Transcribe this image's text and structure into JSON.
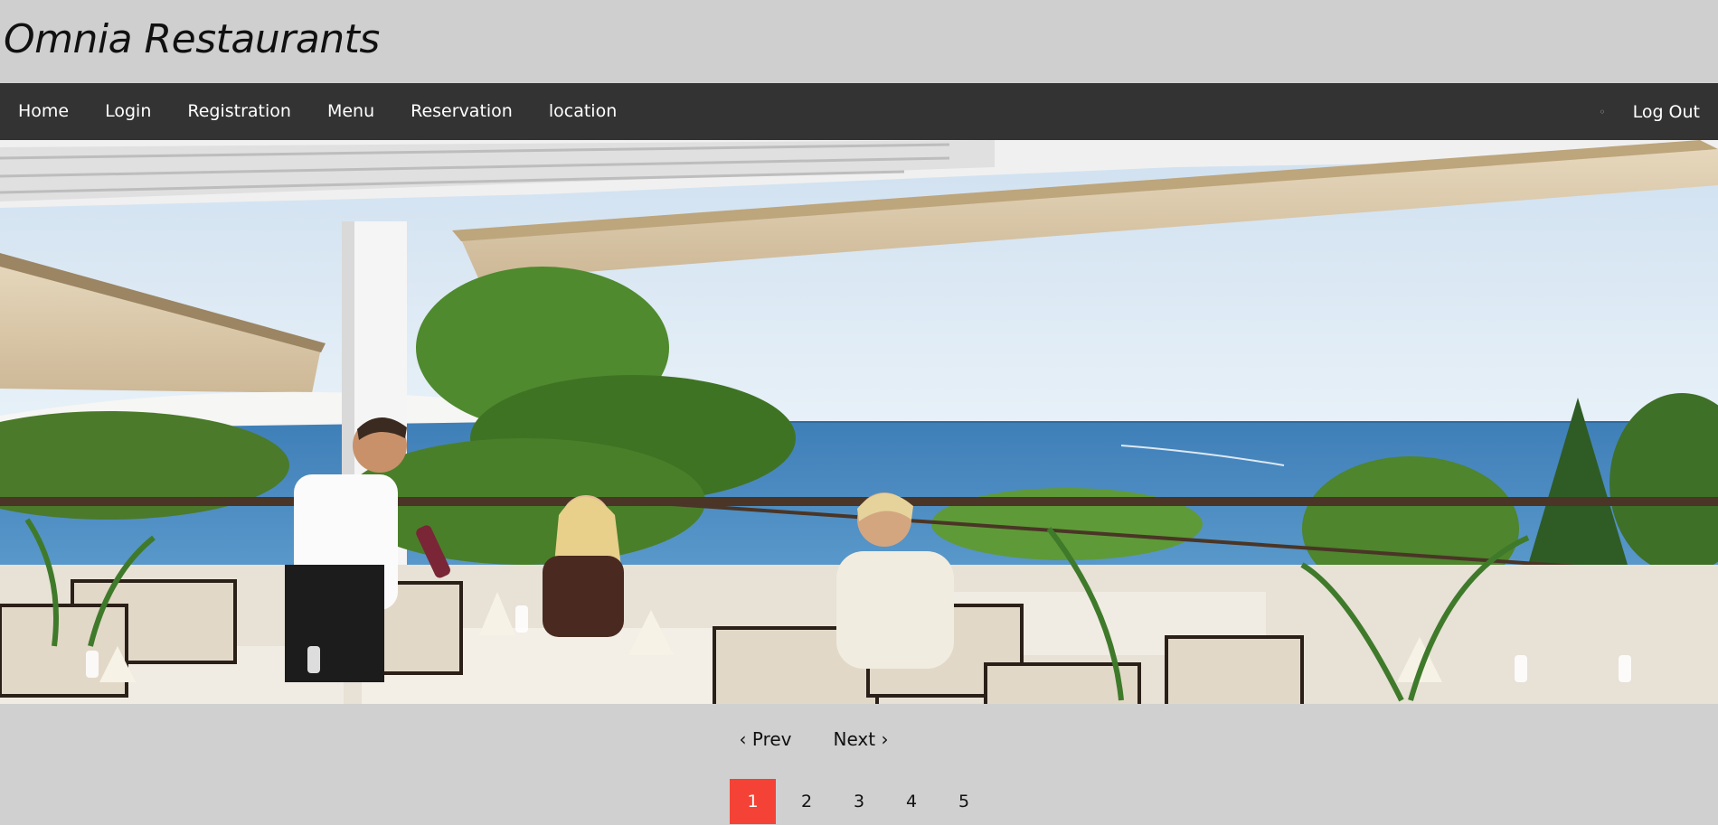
{
  "header": {
    "title": "Omnia Restaurants"
  },
  "nav": {
    "items": [
      {
        "label": "Home"
      },
      {
        "label": "Login"
      },
      {
        "label": "Registration"
      },
      {
        "label": "Menu"
      },
      {
        "label": "Reservation"
      },
      {
        "label": "location"
      }
    ],
    "dot": "◦",
    "logout": "Log Out"
  },
  "slideshow": {
    "prev_label": "‹ Prev",
    "next_label": "Next ›",
    "pages": [
      "1",
      "2",
      "3",
      "4",
      "5"
    ],
    "active_page": "1"
  },
  "colors": {
    "nav_bg": "#333333",
    "page_bg": "#d0d0d0",
    "active_page": "#f44336"
  }
}
